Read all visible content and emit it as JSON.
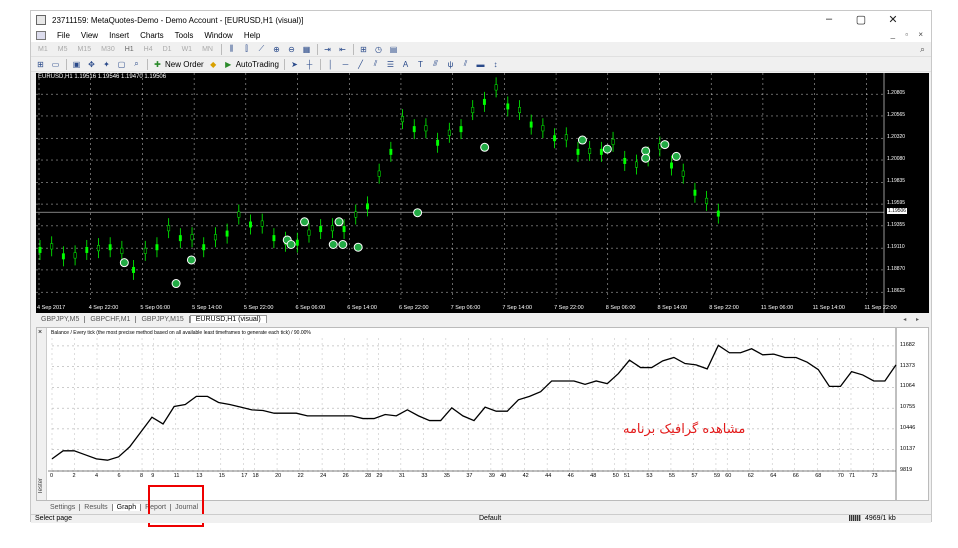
{
  "window": {
    "title": "23711159: MetaQuotes-Demo - Demo Account - [EURUSD,H1 (visual)]",
    "controls": {
      "minimize": "–",
      "maximize": "▢",
      "close": "✕"
    },
    "mdi_controls": "_ ▫ ×"
  },
  "menu": [
    "File",
    "View",
    "Insert",
    "Charts",
    "Tools",
    "Window",
    "Help"
  ],
  "toolbar1": {
    "timeframes": [
      "M1",
      "M5",
      "M15",
      "M30",
      "H1",
      "H4",
      "D1",
      "W1",
      "MN"
    ]
  },
  "toolbar2": {
    "new_order": "New Order",
    "autotrading": "AutoTrading"
  },
  "chart": {
    "label": "EURUSD,H1  1.19516 1.19546 1.19470 1.19506",
    "price_ticks": [
      "1.20805",
      "1.20565",
      "1.20320",
      "1.20080",
      "1.19835",
      "1.19595",
      "1.19506",
      "1.19355",
      "1.19110",
      "1.18870",
      "1.18625"
    ],
    "current_price": "1.19506",
    "time_ticks": [
      "4 Sep 2017",
      "4 Sep 22:00",
      "5 Sep 06:00",
      "5 Sep 14:00",
      "5 Sep 22:00",
      "6 Sep 06:00",
      "6 Sep 14:00",
      "6 Sep 22:00",
      "7 Sep 06:00",
      "7 Sep 14:00",
      "7 Sep 22:00",
      "8 Sep 06:00",
      "8 Sep 14:00",
      "8 Sep 22:00",
      "11 Sep 06:00",
      "11 Sep 14:00",
      "11 Sep 22:00"
    ],
    "colors": {
      "background": "#000000",
      "candles": "#00ff00",
      "grid": "#ffffff"
    }
  },
  "chart_tabs": [
    "GBPJPY,M5",
    "GBPCHF,M1",
    "GBPJPY,M15",
    "EURUSD,H1 (visual)"
  ],
  "tester": {
    "side_label": "Tester",
    "close": "×",
    "graph_title": "Balance / Every tick (the most precise method based on all available least timeframes to generate each tick) / 90.00%",
    "note": "مشاهده گرافیک برنامه"
  },
  "chart_data": {
    "type": "line",
    "title": "Balance / Every tick (the most precise method based on all available least timeframes to generate each tick) / 90.00%",
    "x_ticks": [
      "0",
      "2",
      "4",
      "6",
      "8",
      "9",
      "11",
      "13",
      "15",
      "17",
      "18",
      "20",
      "22",
      "24",
      "26",
      "28",
      "29",
      "31",
      "33",
      "35",
      "37",
      "39",
      "40",
      "42",
      "44",
      "46",
      "48",
      "50",
      "51",
      "53",
      "55",
      "57",
      "59",
      "60",
      "62",
      "64",
      "66",
      "68",
      "70",
      "71",
      "73"
    ],
    "y_ticks": [
      "11682",
      "11373",
      "11064",
      "10755",
      "10446",
      "10137",
      "9819"
    ],
    "ylim": [
      9819,
      11800
    ],
    "series": [
      {
        "values": [
          10000,
          10120,
          10120,
          10060,
          10000,
          9980,
          10030,
          10180,
          10400,
          10620,
          10520,
          10780,
          10810,
          10930,
          10930,
          10840,
          10810,
          10770,
          10730,
          10720,
          10680,
          10680,
          10680,
          10640,
          10640,
          10640,
          10640,
          10640,
          10600,
          10600,
          10660,
          10640,
          10730,
          10640,
          10570,
          10570,
          10760,
          10640,
          10570,
          10770,
          10710,
          10710,
          10880,
          10930,
          11000,
          11160,
          11160,
          11160,
          11110,
          11160,
          11120,
          11270,
          11470,
          11360,
          11360,
          11460,
          11510,
          11420,
          11400,
          11340,
          11690,
          11580,
          11580,
          11640,
          11550,
          11560,
          11510,
          11510,
          11440,
          11330,
          11080,
          11080,
          11300,
          11250,
          11160,
          11160,
          11400
        ]
      }
    ],
    "color": "#000000"
  },
  "bottom_tabs": [
    "Settings",
    "Results",
    "Graph",
    "Report",
    "Journal"
  ],
  "active_bottom_tab": "Graph",
  "status": {
    "left": "Select page",
    "profile": "Default",
    "traffic": "4969/1 kb"
  }
}
